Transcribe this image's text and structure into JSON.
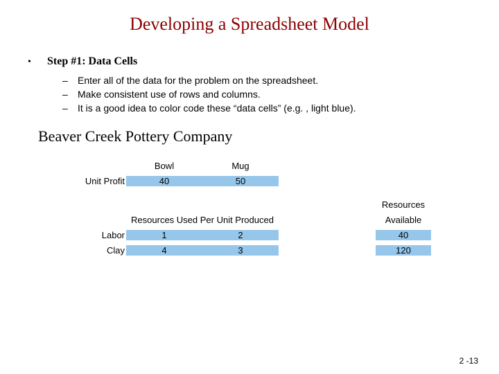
{
  "title": "Developing a Spreadsheet Model",
  "step": {
    "label": "Step #1: Data Cells",
    "items": [
      "Enter all of the data for the problem on the spreadsheet.",
      "Make consistent use of rows and columns.",
      "It is a good idea to color code these “data cells” (e.g. , light blue)."
    ]
  },
  "company": "Beaver Creek Pottery Company",
  "table": {
    "col1": "Bowl",
    "col2": "Mug",
    "unit_profit_label": "Unit Profit",
    "unit_profit": {
      "bowl": "40",
      "mug": "50"
    },
    "section_header": "Resources Used Per Unit Produced",
    "resources_header1": "Resources",
    "resources_header2": "Available",
    "labor_label": "Labor",
    "labor": {
      "bowl": "1",
      "mug": "2",
      "avail": "40"
    },
    "clay_label": "Clay",
    "clay": {
      "bowl": "4",
      "mug": "3",
      "avail": "120"
    }
  },
  "page_number": "2 -13"
}
